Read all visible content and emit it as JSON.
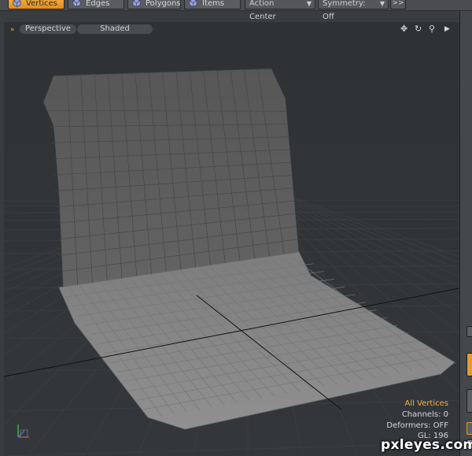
{
  "toolbar": {
    "modes": [
      {
        "label": "Vertices",
        "active": true
      },
      {
        "label": "Edges",
        "active": false
      },
      {
        "label": "Polygons",
        "active": false
      },
      {
        "label": "Items",
        "active": false
      }
    ],
    "action_center": "Action Center",
    "symmetry": "Symmetry: Off",
    "more": ">>"
  },
  "viewport": {
    "projection": "Perspective",
    "shading": "Shaded",
    "icons": [
      "move-view-icon",
      "rotate-view-icon",
      "zoom-view-icon",
      "expand-arrow-icon"
    ]
  },
  "stats": {
    "selection": "All Vertices",
    "channels": "Channels: 0",
    "deformers": "Deformers: OFF",
    "gl": "GL: 196"
  },
  "watermark": "pxleyes.com",
  "colors": {
    "accent": "#f2b239",
    "background": "#2f3337",
    "mesh_back": "#5a5a5a",
    "mesh_floor": "#8a8a8a"
  }
}
